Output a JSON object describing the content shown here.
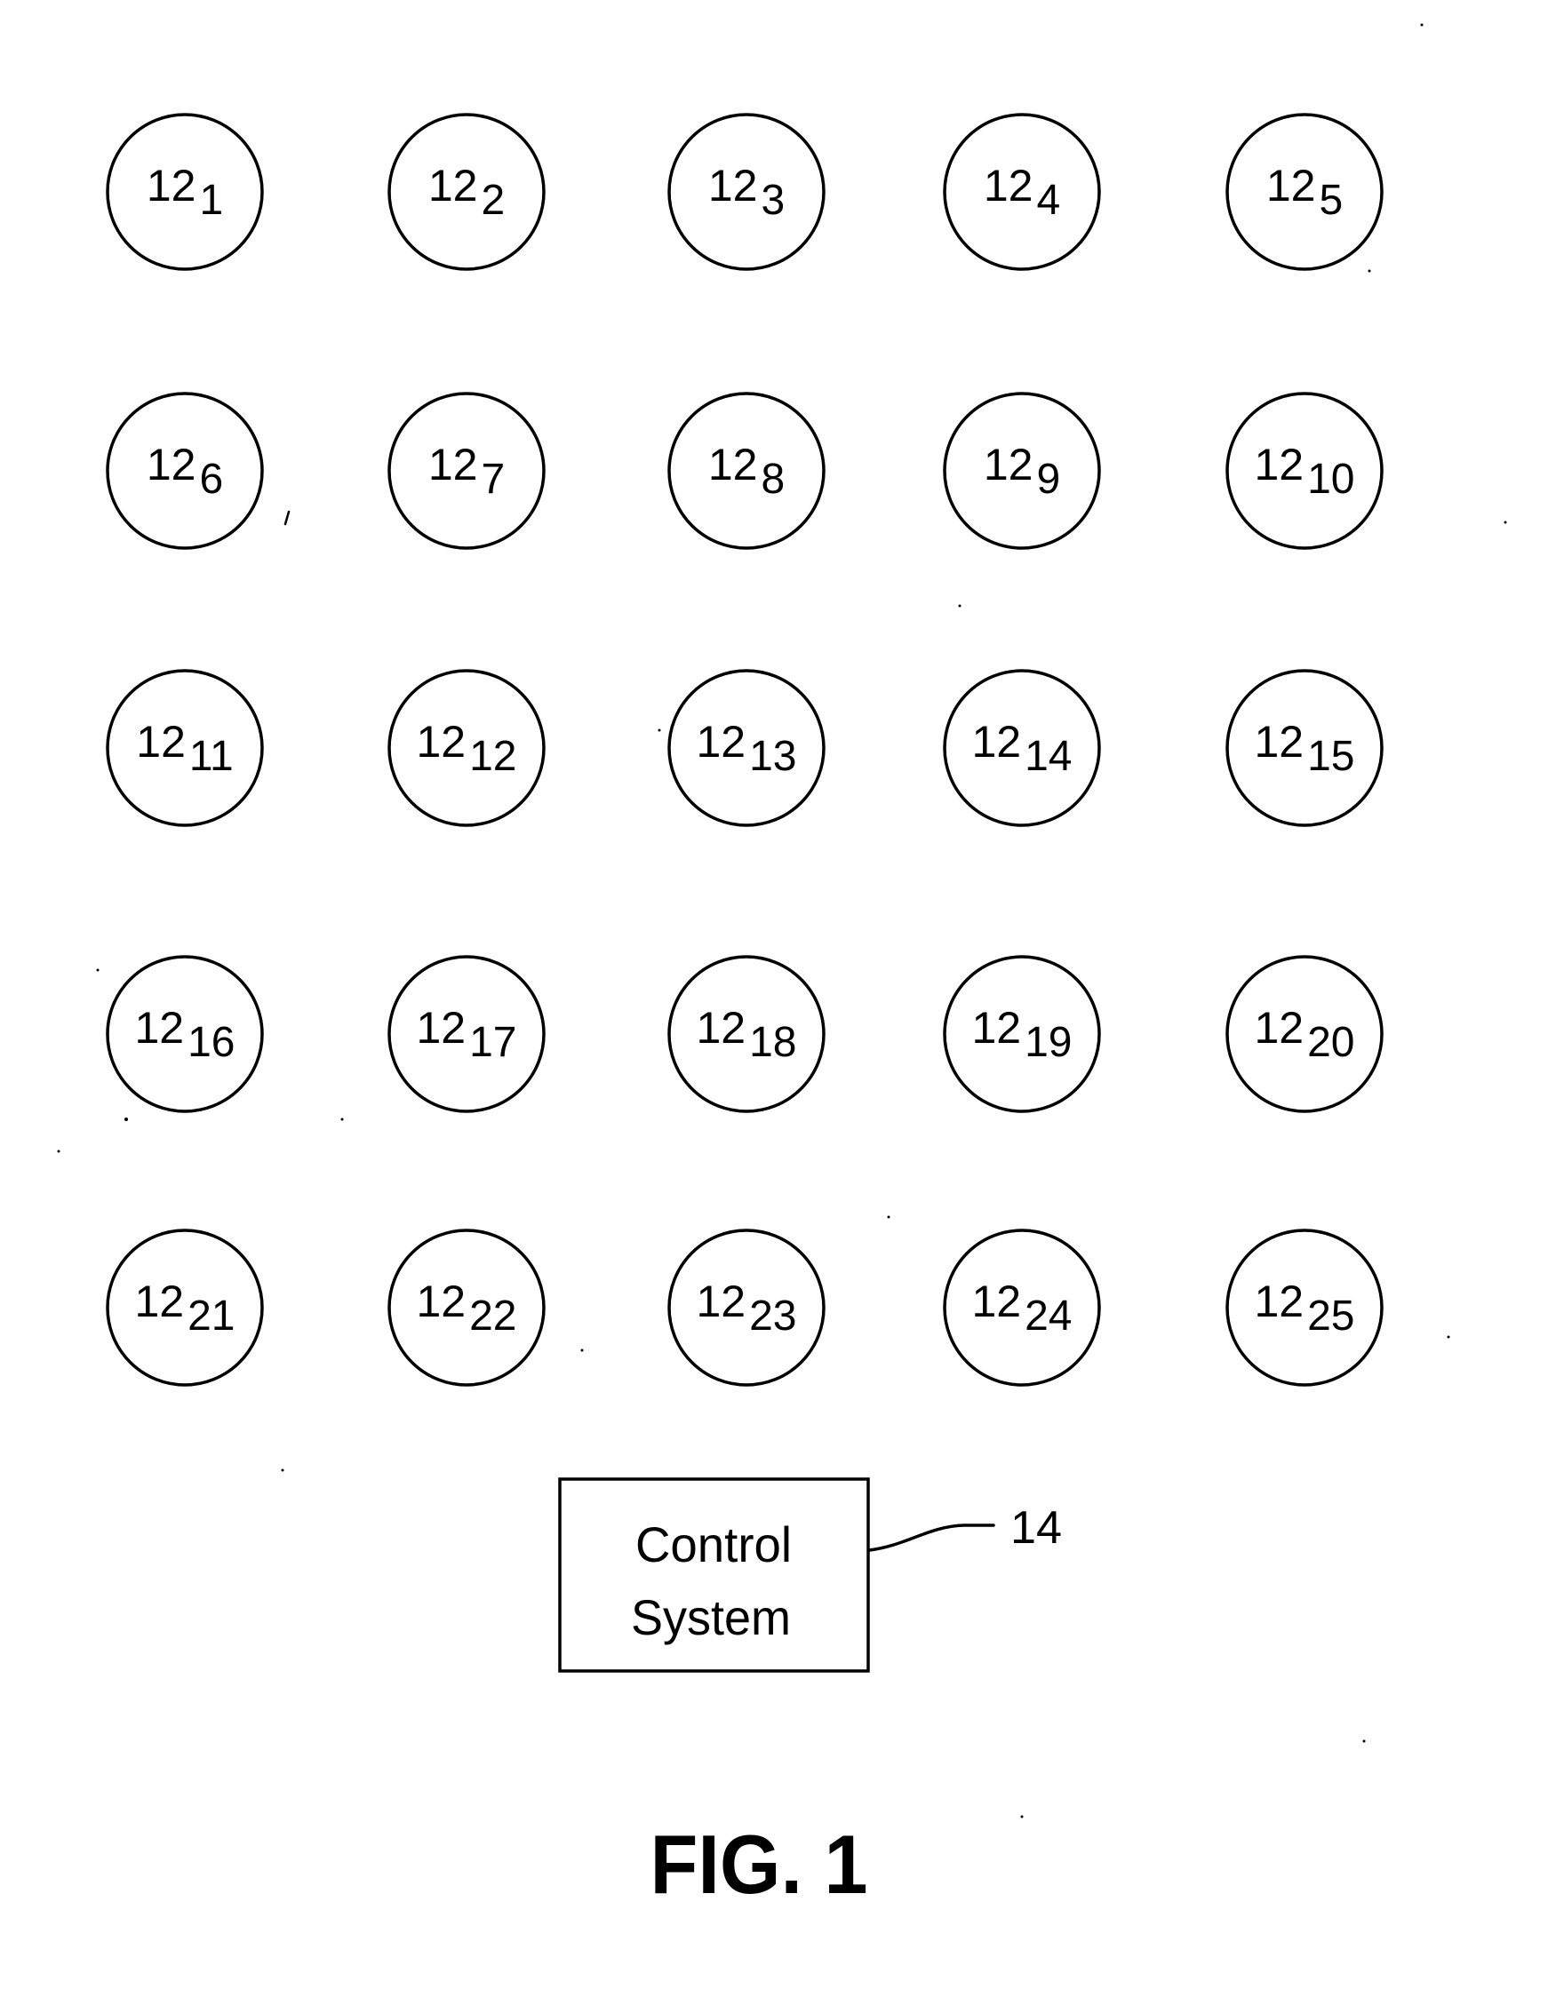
{
  "figure": {
    "title": "FIG. 1",
    "grid": {
      "rows": 5,
      "columns": 5,
      "nodes": [
        {
          "base": "12",
          "sub": "1"
        },
        {
          "base": "12",
          "sub": "2"
        },
        {
          "base": "12",
          "sub": "3"
        },
        {
          "base": "12",
          "sub": "4"
        },
        {
          "base": "12",
          "sub": "5"
        },
        {
          "base": "12",
          "sub": "6"
        },
        {
          "base": "12",
          "sub": "7"
        },
        {
          "base": "12",
          "sub": "8"
        },
        {
          "base": "12",
          "sub": "9"
        },
        {
          "base": "12",
          "sub": "10"
        },
        {
          "base": "12",
          "sub": "11"
        },
        {
          "base": "12",
          "sub": "12"
        },
        {
          "base": "12",
          "sub": "13"
        },
        {
          "base": "12",
          "sub": "14"
        },
        {
          "base": "12",
          "sub": "15"
        },
        {
          "base": "12",
          "sub": "16"
        },
        {
          "base": "12",
          "sub": "17"
        },
        {
          "base": "12",
          "sub": "18"
        },
        {
          "base": "12",
          "sub": "19"
        },
        {
          "base": "12",
          "sub": "20"
        },
        {
          "base": "12",
          "sub": "21"
        },
        {
          "base": "12",
          "sub": "22"
        },
        {
          "base": "12",
          "sub": "23"
        },
        {
          "base": "12",
          "sub": "24"
        },
        {
          "base": "12",
          "sub": "25"
        }
      ]
    },
    "control_system": {
      "line1": "Control",
      "line2": "System",
      "reference": "14"
    }
  }
}
